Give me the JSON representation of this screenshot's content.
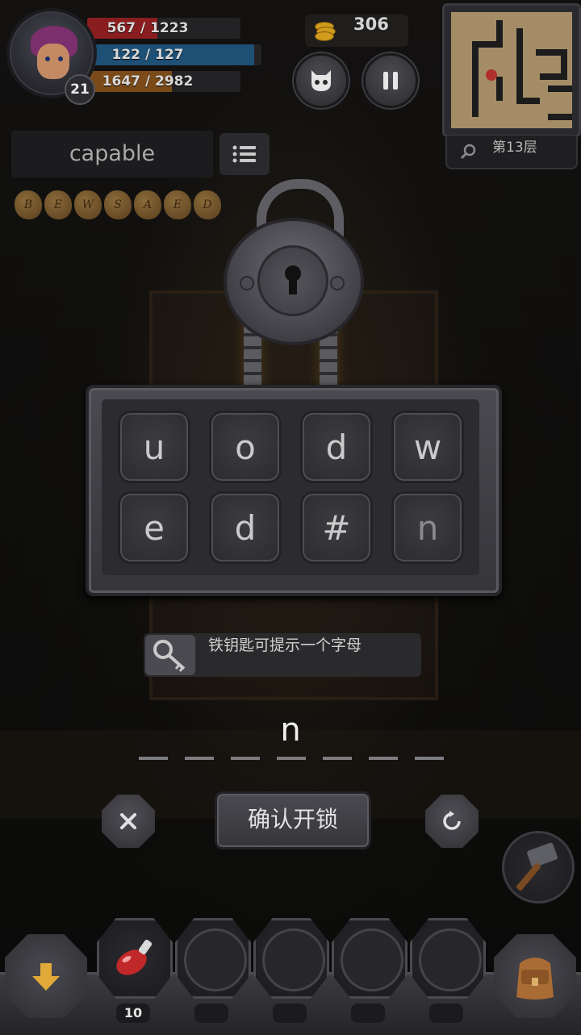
{
  "player": {
    "level": "21",
    "hp": "567 / 1223",
    "hp_fill": 0.46,
    "mp": "122 / 127",
    "mp_fill": 0.96,
    "xp": "1647 / 2982",
    "xp_fill": 0.55
  },
  "gold": "306",
  "floor": "第13层",
  "word": "capable",
  "runes": [
    "B",
    "E",
    "W",
    "S",
    "A",
    "E",
    "D"
  ],
  "puzzle": {
    "tiles_row1": [
      "u",
      "o",
      "d",
      "w"
    ],
    "tiles_row2": [
      "e",
      "d",
      "#",
      "n"
    ],
    "hint": "铁钥匙可提示一个字母",
    "answer_letter": "n",
    "answer_slot_count": 7,
    "confirm_label": "确认开锁"
  },
  "inventory": {
    "potion_count": "10"
  },
  "colors": {
    "hp": "#8a1d1f",
    "mp": "#1e4f74",
    "xp": "#7a4a18",
    "gold": "#d19b1d"
  }
}
